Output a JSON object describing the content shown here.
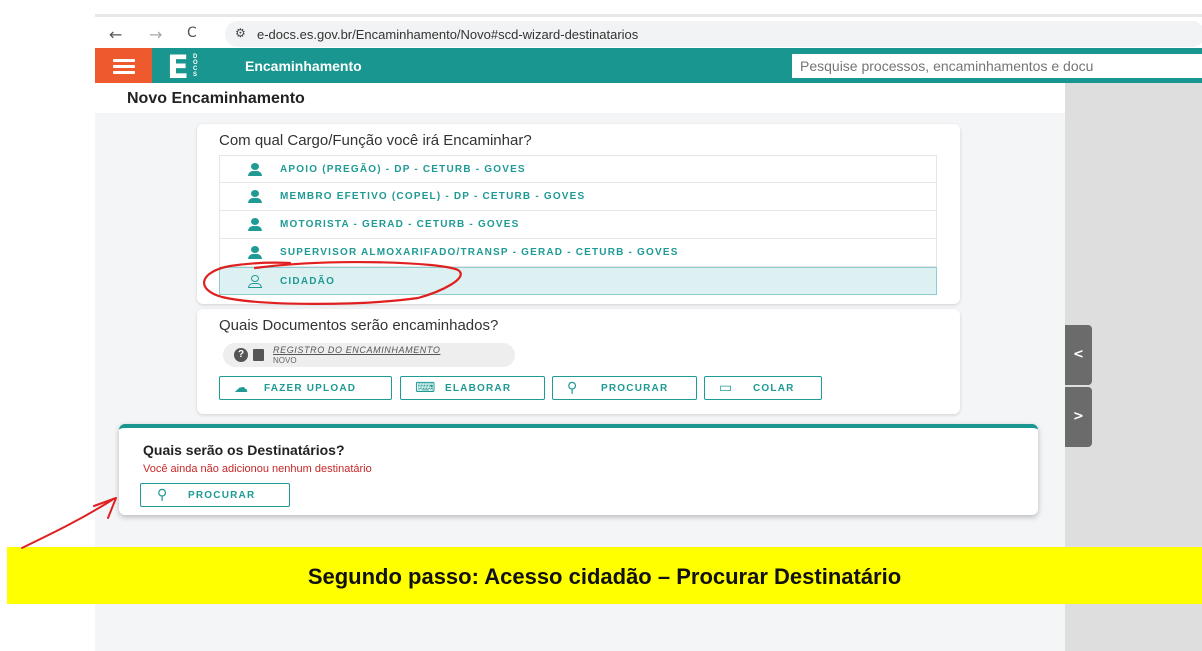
{
  "browser": {
    "back_glyph": "←",
    "forward_glyph": "→",
    "reload_glyph": "C",
    "url": "e-docs.es.gov.br/Encaminhamento/Novo#scd-wizard-destinatarios"
  },
  "app": {
    "logo_letter": "E",
    "logo_sub": "DOCS",
    "title": "Encaminhamento",
    "search_placeholder": "Pesquise processos, encaminhamentos e docu",
    "brand_color": "#18968f",
    "menu_color": "#ee5a2d"
  },
  "page": {
    "title": "Novo Encaminhamento"
  },
  "cargo_card": {
    "question": "Com qual Cargo/Função você irá Encaminhar?",
    "options": [
      {
        "label": "APOIO (PREGÃO) - DP - CETURB - GOVES",
        "icon": "person-icon"
      },
      {
        "label": "MEMBRO EFETIVO (COPEL) - DP - CETURB - GOVES",
        "icon": "person-icon"
      },
      {
        "label": "MOTORISTA - GERAD - CETURB - GOVES",
        "icon": "person-icon"
      },
      {
        "label": "SUPERVISOR ALMOXARIFADO/TRANSP - GERAD - CETURB - GOVES",
        "icon": "person-icon"
      },
      {
        "label": "CIDADÃO",
        "icon": "person-outline-icon",
        "selected": true
      }
    ]
  },
  "docs_card": {
    "question": "Quais Documentos serão encaminhados?",
    "document": {
      "name": "REGISTRO DO ENCAMINHAMENTO",
      "status": "NOVO"
    },
    "buttons": {
      "upload": "FAZER UPLOAD",
      "elaborar": "ELABORAR",
      "procurar": "PROCURAR",
      "colar": "COLAR"
    }
  },
  "dest_card": {
    "question": "Quais serão os Destinatários?",
    "empty_message": "Você ainda não adicionou nenhum destinatário",
    "search_button": "PROCURAR"
  },
  "side_tabs": {
    "collapse": "<",
    "expand": ">"
  },
  "banner": {
    "text": "Segundo passo: Acesso cidadão – Procurar Destinatário",
    "color": "#ffff00"
  }
}
